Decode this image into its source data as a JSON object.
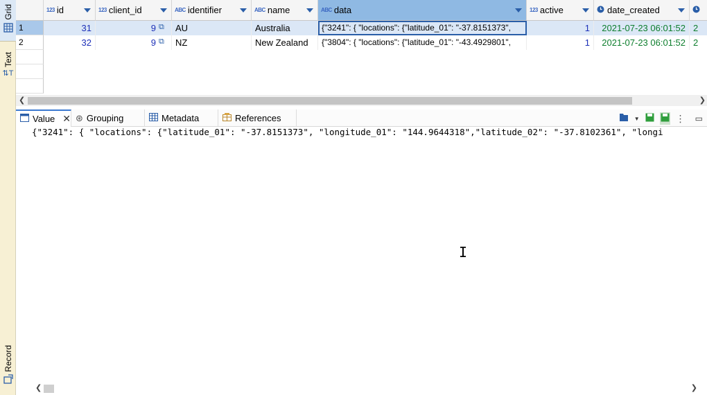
{
  "sidebar": {
    "tabs": [
      {
        "label": "Grid",
        "icon": "grid-icon"
      },
      {
        "label": "Text",
        "icon": "text-icon"
      },
      {
        "label": "Record",
        "icon": "record-icon"
      }
    ]
  },
  "grid": {
    "columns": [
      {
        "label": "id",
        "type_icon": "123"
      },
      {
        "label": "client_id",
        "type_icon": "123"
      },
      {
        "label": "identifier",
        "type_icon": "ABC"
      },
      {
        "label": "name",
        "type_icon": "ABC"
      },
      {
        "label": "data",
        "type_icon": "ABC"
      },
      {
        "label": "active",
        "type_icon": "123"
      },
      {
        "label": "date_created",
        "type_icon": "clock"
      }
    ],
    "rows": [
      {
        "num": "1",
        "id": "31",
        "client_id": "9",
        "identifier": "AU",
        "name": "Australia",
        "data": "{\"3241\": { \"locations\": {\"latitude_01\": \"-37.8151373\",",
        "active": "1",
        "date_created": "2021-07-23 06:01:52",
        "extra": "2"
      },
      {
        "num": "2",
        "id": "32",
        "client_id": "9",
        "identifier": "NZ",
        "name": "New Zealand",
        "data": "{\"3804\": { \"locations\": {\"latitude_01\": \"-43.4929801\",",
        "active": "1",
        "date_created": "2021-07-23 06:01:52",
        "extra": "2"
      }
    ]
  },
  "panel": {
    "tabs": [
      {
        "label": "Value"
      },
      {
        "label": "Grouping"
      },
      {
        "label": "Metadata"
      },
      {
        "label": "References"
      }
    ],
    "value_text": "{\"3241\": { \"locations\": {\"latitude_01\": \"-37.8151373\", \"longitude_01\": \"144.9644318\",\"latitude_02\": \"-37.8102361\", \"longi"
  },
  "colors": {
    "accent": "#3b78d0",
    "number": "#1c2fb8",
    "date": "#0d7e2d",
    "sidebar": "#f7f0d4"
  }
}
